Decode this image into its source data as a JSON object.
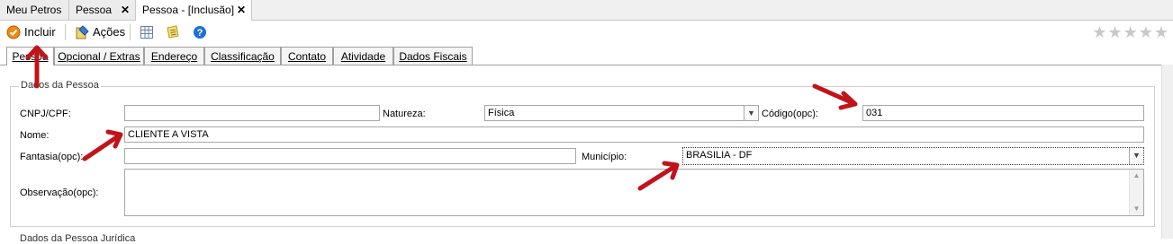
{
  "doc_tabs": [
    {
      "label": "Meu Petros",
      "active": false,
      "closable": false
    },
    {
      "label": "Pessoa",
      "active": false,
      "closable": true
    },
    {
      "label": "Pessoa - [Inclusão]",
      "active": true,
      "closable": true
    }
  ],
  "toolbar": {
    "include_label": "Incluir",
    "actions_label": "Ações",
    "icons": [
      "check-circle-icon",
      "actions-wand-icon",
      "grid-icon",
      "notes-icon",
      "help-icon"
    ],
    "rating_stars": 5
  },
  "form_tabs": [
    {
      "label": "Pessoa",
      "active": true
    },
    {
      "label": "Opcional / Extras",
      "active": false
    },
    {
      "label": "Endereço",
      "active": false
    },
    {
      "label": "Classificação",
      "active": false
    },
    {
      "label": "Contato",
      "active": false
    },
    {
      "label": "Atividade",
      "active": false
    },
    {
      "label": "Dados Fiscais",
      "active": false
    }
  ],
  "group": {
    "title": "Dados da Pessoa",
    "cnpj_label": "CNPJ/CPF:",
    "cnpj_value": "",
    "natureza_label": "Natureza:",
    "natureza_value": "Física",
    "codigo_label": "Código(opc):",
    "codigo_value": "031",
    "nome_label": "Nome:",
    "nome_value": "CLIENTE A VISTA",
    "fantasia_label": "Fantasia(opc):",
    "fantasia_value": "",
    "municipio_label": "Município:",
    "municipio_value": "BRASILIA - DF",
    "observacao_label": "Observação(opc):",
    "observacao_value": ""
  },
  "next_group_title": "Dados da Pessoa Jurídica",
  "colors": {
    "annotation_arrow": "#c0141a",
    "star": "#c8c8c8",
    "tab_border": "#a0a0a0",
    "help_blue": "#1e6fd9"
  }
}
